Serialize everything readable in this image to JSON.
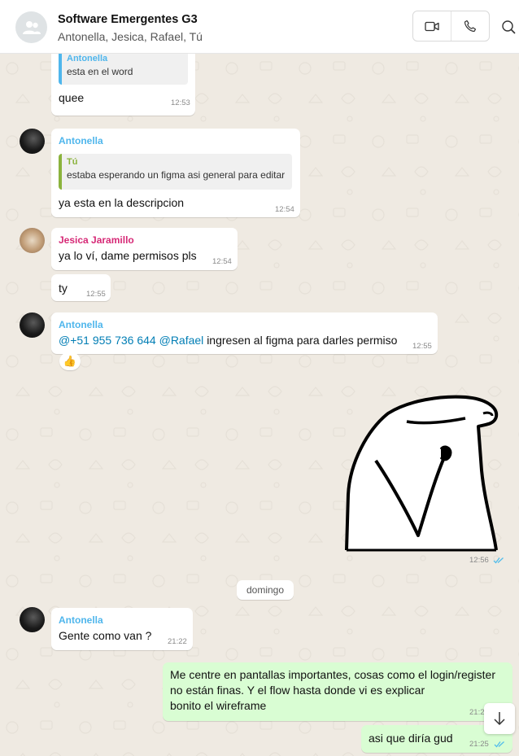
{
  "header": {
    "title": "Software Emergentes G3",
    "members": "Antonella, Jesica, Rafael, Tú",
    "video_icon": "video-camera-icon",
    "call_icon": "phone-icon",
    "search_icon": "search-icon"
  },
  "colors": {
    "antonella": "#4fb6ec",
    "jesica": "#d62976",
    "tu": "#8bb33d",
    "read_ticks": "#53bdeb",
    "outgoing_bubble": "#d9fdd3",
    "chat_background": "#efeae2"
  },
  "messages": [
    {
      "quote_name": "Antonella",
      "quote_text": "esta en el word",
      "text": "quee",
      "time": "12:53"
    },
    {
      "sender": "Antonella",
      "quote_name": "Tú",
      "quote_text": "estaba esperando un figma asi general para editar",
      "text": "ya esta en la descripcion",
      "time": "12:54"
    },
    {
      "sender": "Jesica Jaramillo",
      "text": "ya lo ví, dame permisos pls",
      "time": "12:54"
    },
    {
      "text": "ty",
      "time": "12:55"
    },
    {
      "sender": "Antonella",
      "mention1": "@+51 955 736 644",
      "mention2": "@Rafael",
      "text": " ingresen al figma para darles permiso",
      "time": "12:55",
      "reaction": "👍"
    },
    {
      "sticker": "sticker-image",
      "time": "12:56"
    },
    {
      "sender": "Antonella",
      "text": "Gente como van ?",
      "time": "21:22"
    },
    {
      "lines": [
        "Me centre en pantallas importantes, cosas como el login/register",
        "no están finas. Y el flow hasta donde vi es explicar",
        "bonito el wireframe"
      ],
      "time": "21:2"
    },
    {
      "text": "asi que diría gud",
      "time": "21:25"
    }
  ],
  "day_separator": "domingo",
  "scroll_icon": "arrow-down-icon"
}
